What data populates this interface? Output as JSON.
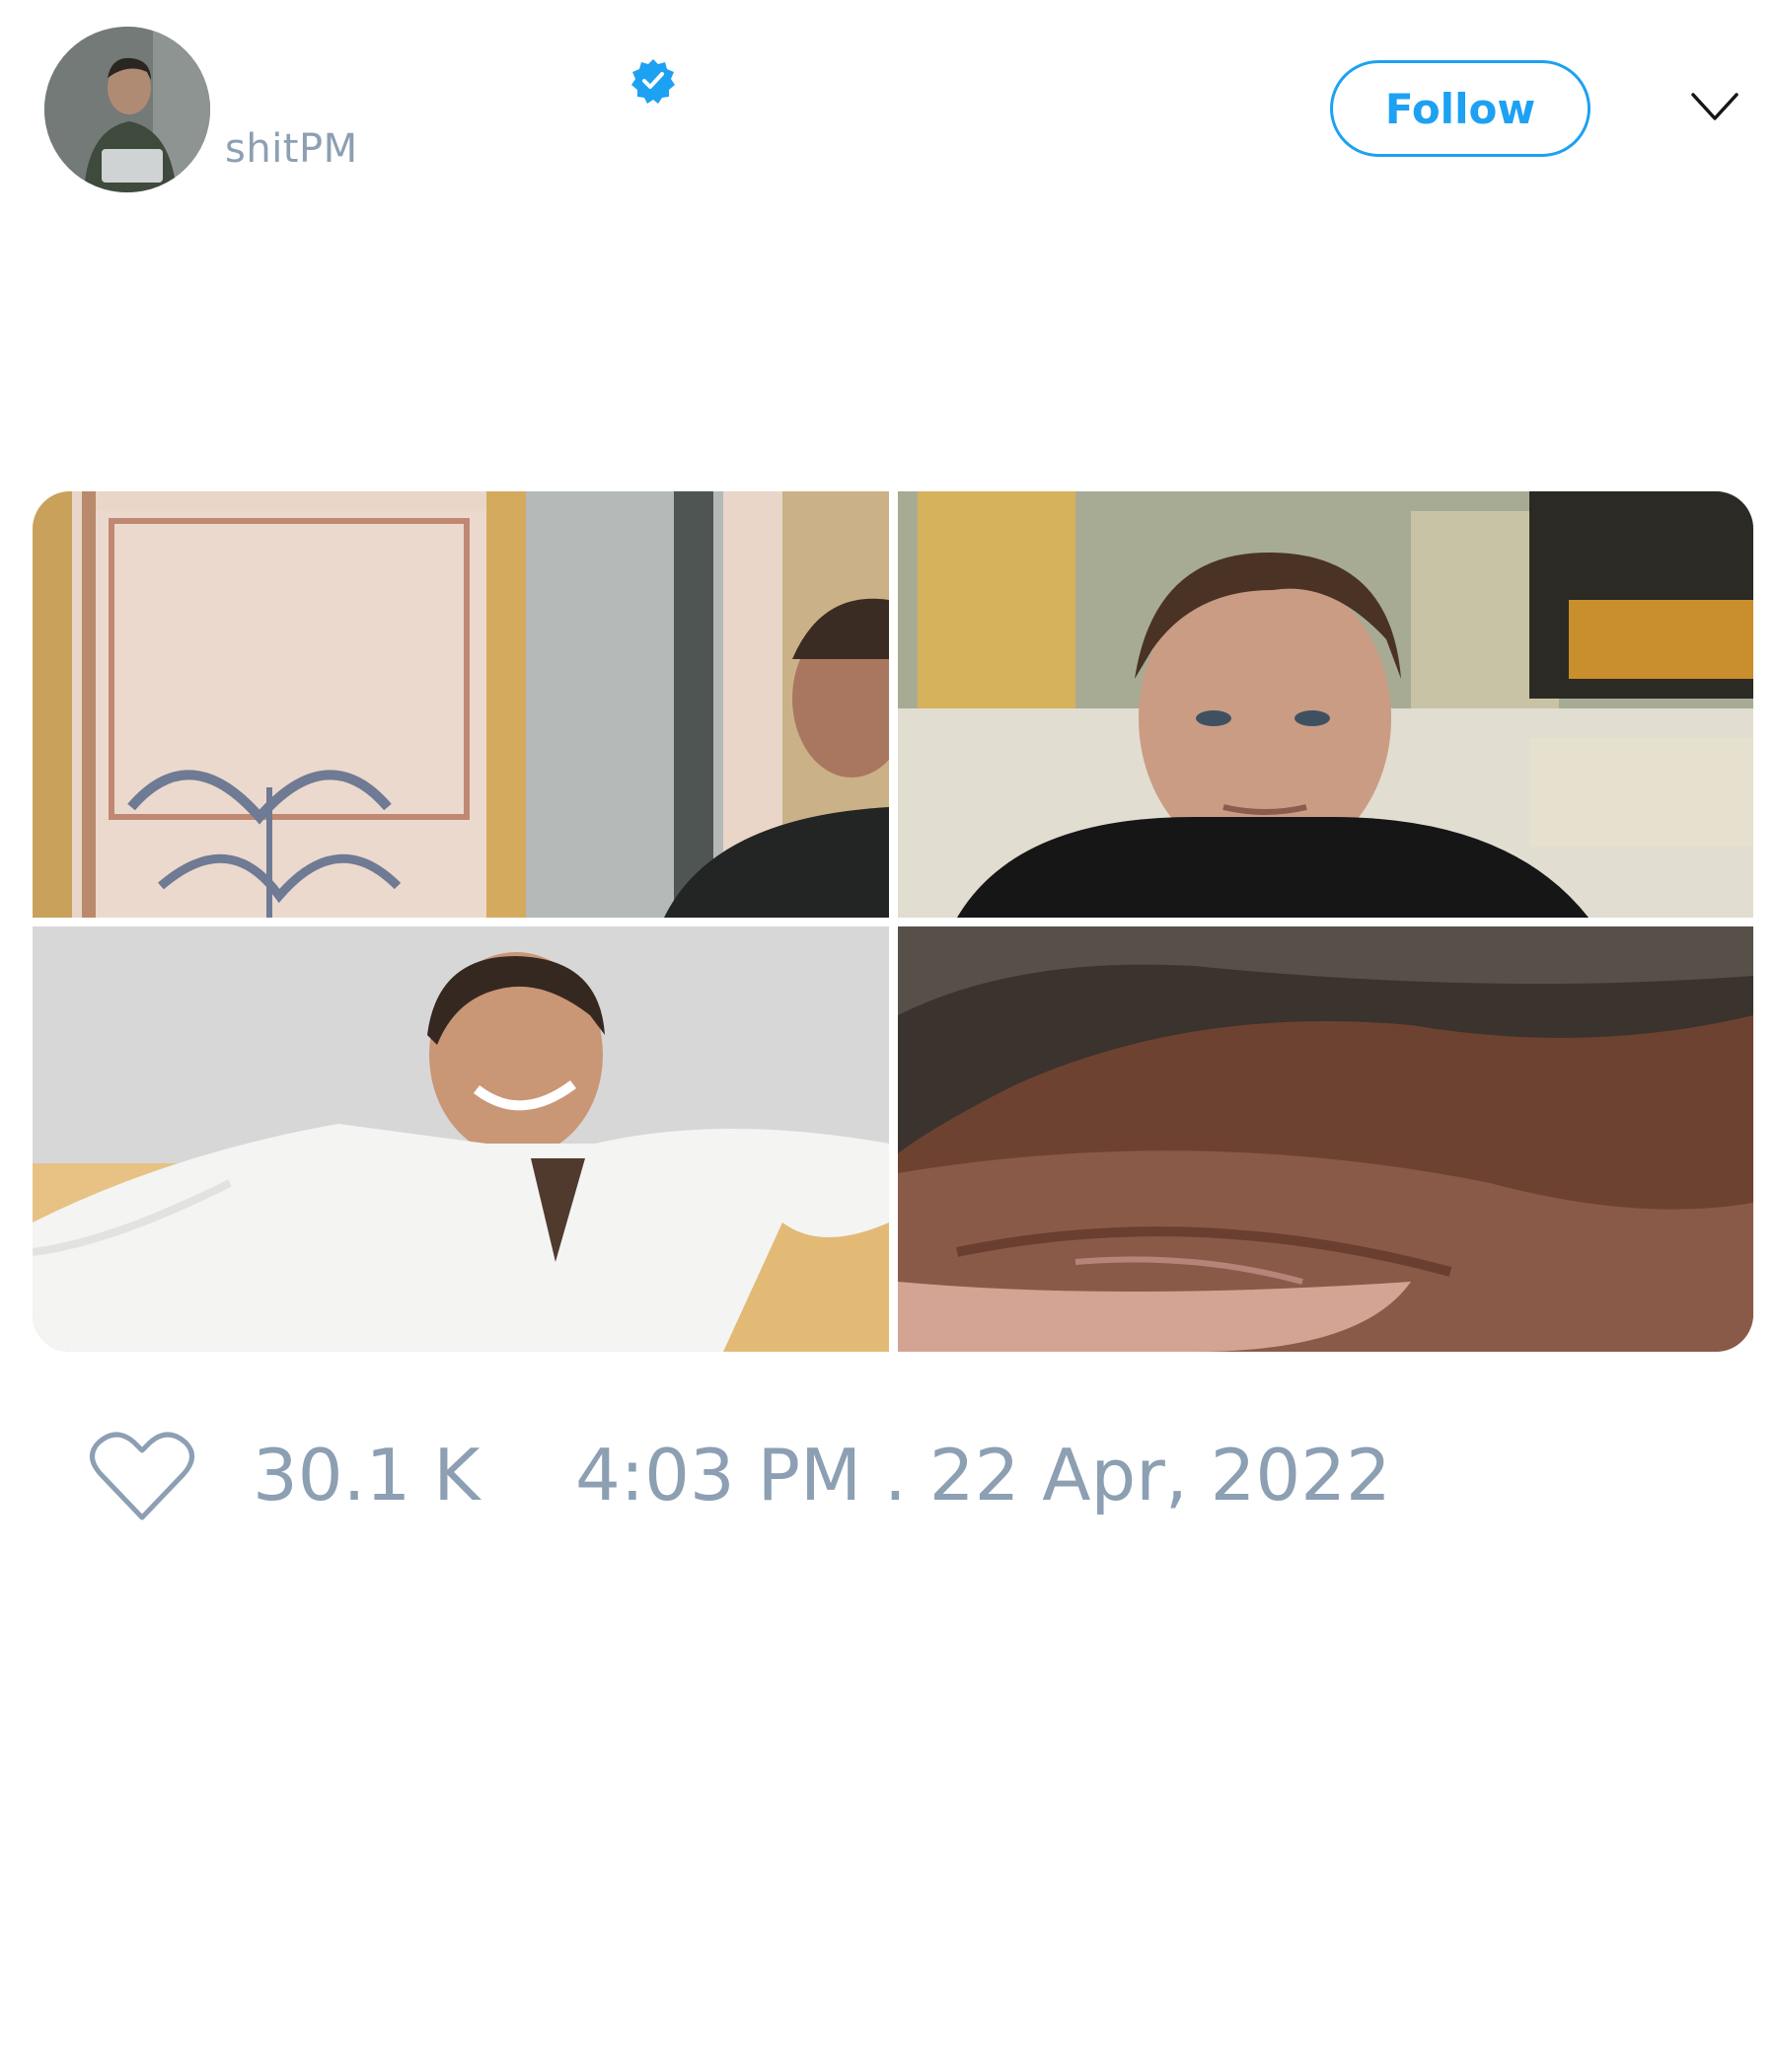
{
  "author": {
    "display_name": "",
    "handle": "shitPM",
    "verified": true,
    "avatar_icon": "profile-photo"
  },
  "actions": {
    "follow_label": "Follow",
    "more_icon": "chevron-down-icon"
  },
  "media": {
    "photos": [
      {
        "icon": "photo-ornate-wall-man-profile"
      },
      {
        "icon": "photo-man-dark-turtleneck"
      },
      {
        "icon": "photo-man-white-shirt-laughing"
      },
      {
        "icon": "photo-closeup-forehead-hand"
      }
    ]
  },
  "footer": {
    "like_icon": "heart-icon",
    "like_count": "30.1 K",
    "timestamp": "4:03 PM . 22 Apr, 2022"
  },
  "colors": {
    "accent": "#1da1f2",
    "muted_text": "#8c9fb3",
    "primary_text": "#14171a"
  }
}
